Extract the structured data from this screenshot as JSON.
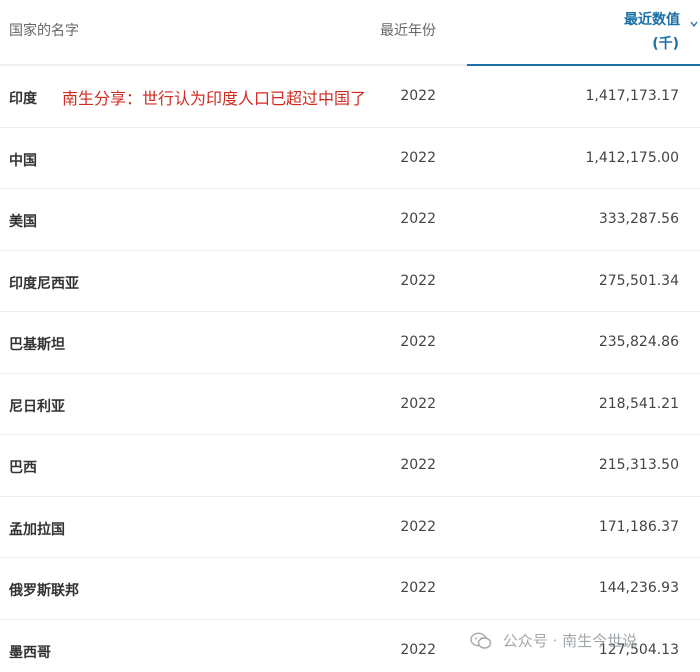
{
  "table": {
    "headers": {
      "country": "国家的名字",
      "year": "最近年份",
      "value_line1": "最近数值",
      "value_line2": "(千)"
    },
    "rows": [
      {
        "country": "印度",
        "year": "2022",
        "value": "1,417,173.17"
      },
      {
        "country": "中国",
        "year": "2022",
        "value": "1,412,175.00"
      },
      {
        "country": "美国",
        "year": "2022",
        "value": "333,287.56"
      },
      {
        "country": "印度尼西亚",
        "year": "2022",
        "value": "275,501.34"
      },
      {
        "country": "巴基斯坦",
        "year": "2022",
        "value": "235,824.86"
      },
      {
        "country": "尼日利亚",
        "year": "2022",
        "value": "218,541.21"
      },
      {
        "country": "巴西",
        "year": "2022",
        "value": "215,313.50"
      },
      {
        "country": "孟加拉国",
        "year": "2022",
        "value": "171,186.37"
      },
      {
        "country": "俄罗斯联邦",
        "year": "2022",
        "value": "144,236.93"
      },
      {
        "country": "墨西哥",
        "year": "2022",
        "value": "127,504.13"
      }
    ]
  },
  "annotation": {
    "text": "南生分享：世行认为印度人口已超过中国了",
    "color": "#d12a20"
  },
  "watermark": {
    "text": "公众号 · 南生今世说",
    "icon": "wechat-icon"
  },
  "colors": {
    "accent": "#1b6fa8",
    "row_divider": "#eceef0"
  }
}
